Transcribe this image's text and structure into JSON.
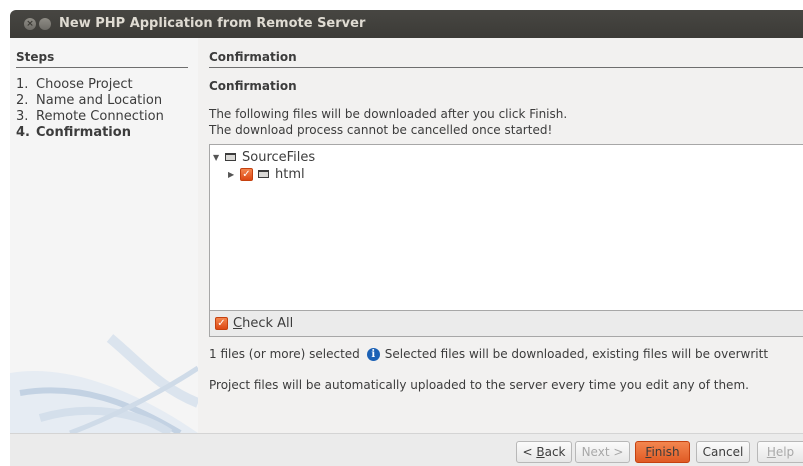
{
  "window": {
    "title": "New PHP Application from Remote Server"
  },
  "steps": {
    "heading": "Steps",
    "items": [
      {
        "num": "1.",
        "label": "Choose Project"
      },
      {
        "num": "2.",
        "label": "Name and Location"
      },
      {
        "num": "3.",
        "label": "Remote Connection"
      },
      {
        "num": "4.",
        "label": "Confirmation"
      }
    ]
  },
  "content": {
    "heading": "Confirmation",
    "subheading": "Confirmation",
    "desc_line1": "The following files will be downloaded after you click Finish.",
    "desc_line2": "The download process cannot be cancelled once started!",
    "tree": {
      "root_label": "SourceFiles",
      "child_label": "html"
    },
    "check_all": {
      "underlined": "C",
      "rest": "heck All"
    },
    "selected_count": "1 files (or more) selected",
    "selected_info": "Selected files will be downloaded, existing files will be overwritt",
    "auto_upload": "Project files will be automatically uploaded to the server every time you edit any of them."
  },
  "footer": {
    "back": {
      "prefix": "< ",
      "underlined": "B",
      "rest": "ack"
    },
    "next": "Next >",
    "finish": {
      "underlined": "F",
      "rest": "inish"
    },
    "cancel": "Cancel",
    "help": {
      "underlined": "H",
      "rest": "elp"
    }
  },
  "colors": {
    "accent": "#dd4814",
    "titlebar": "#3c3b37",
    "info": "#1c61b5"
  }
}
